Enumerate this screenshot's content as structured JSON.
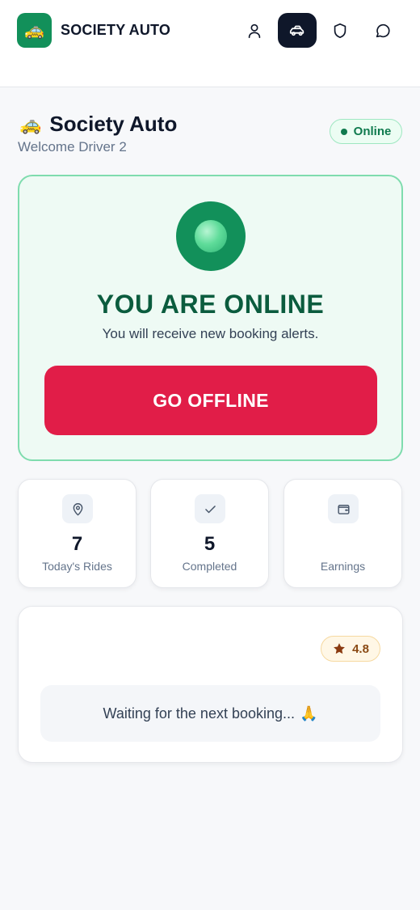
{
  "header": {
    "logo_emoji": "🚕",
    "brand": "SOCIETY AUTO",
    "nav": [
      {
        "name": "profile",
        "icon": "user-icon",
        "active": false
      },
      {
        "name": "rides",
        "icon": "car-icon",
        "active": true
      },
      {
        "name": "safety",
        "icon": "shield-icon",
        "active": false
      },
      {
        "name": "chat",
        "icon": "message-icon",
        "active": false
      }
    ]
  },
  "page": {
    "title_emoji": "🚕",
    "title": "Society Auto",
    "welcome": "Welcome Driver 2",
    "status": "Online"
  },
  "online_card": {
    "heading": "YOU ARE ONLINE",
    "subtitle": "You will receive new booking alerts.",
    "button_label": "GO OFFLINE"
  },
  "stats": [
    {
      "icon": "map-pin-icon",
      "value": "7",
      "label": "Today's Rides"
    },
    {
      "icon": "check-icon",
      "value": "5",
      "label": "Completed"
    },
    {
      "icon": "wallet-icon",
      "value": "",
      "label": "Earnings"
    }
  ],
  "booking": {
    "rating": "4.8",
    "waiting_text": "Waiting for the next booking...",
    "waiting_emoji": "🙏"
  },
  "colors": {
    "brand_green": "#12905a",
    "danger": "#e11d48",
    "dark": "#0f172a",
    "online_bg": "#eefaf4"
  }
}
